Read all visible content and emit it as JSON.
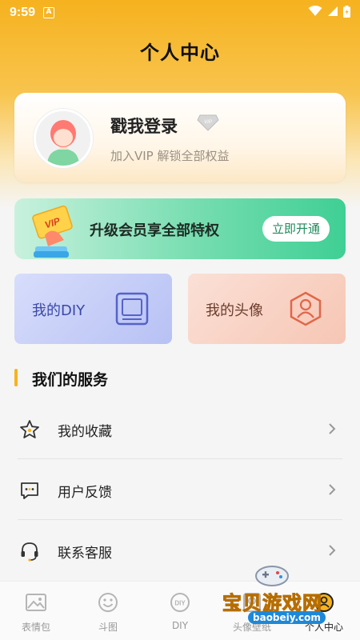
{
  "status": {
    "time": "9:59",
    "notification_badge": "A"
  },
  "header": {
    "title": "个人中心"
  },
  "login": {
    "title": "戳我登录",
    "subtitle": "加入VIP 解锁全部权益",
    "vip_badge": "VIP"
  },
  "vip_banner": {
    "text": "升级会员享全部特权",
    "button": "立即开通",
    "card_label": "VIP"
  },
  "tiles": [
    {
      "label": "我的DIY",
      "icon": "frame-icon"
    },
    {
      "label": "我的头像",
      "icon": "user-hexagon-icon"
    }
  ],
  "services": {
    "title": "我们的服务",
    "items": [
      {
        "label": "我的收藏",
        "icon": "star-icon"
      },
      {
        "label": "用户反馈",
        "icon": "chat-icon"
      },
      {
        "label": "联系客服",
        "icon": "headset-icon"
      }
    ]
  },
  "tabs": [
    {
      "label": "表情包",
      "icon": "image-icon"
    },
    {
      "label": "斗图",
      "icon": "smile-icon"
    },
    {
      "label": "DIY",
      "icon": "diy-icon"
    },
    {
      "label": "头像壁纸",
      "icon": "wallpaper-icon"
    },
    {
      "label": "个人中心",
      "icon": "profile-icon"
    }
  ],
  "watermark": {
    "text": "宝贝游戏网",
    "url": "baobeiy.com"
  },
  "colors": {
    "accent": "#f6b21f",
    "vip_green": "#3fcf94"
  }
}
